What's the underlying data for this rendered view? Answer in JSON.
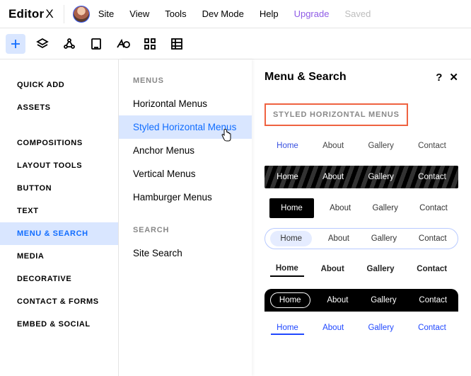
{
  "app": {
    "logo": "Editor",
    "logo_suffix": "X"
  },
  "menubar": {
    "site": "Site",
    "view": "View",
    "tools": "Tools",
    "devmode": "Dev Mode",
    "help": "Help",
    "upgrade": "Upgrade",
    "saved": "Saved"
  },
  "sidebar": {
    "groupA": [
      {
        "label": "QUICK ADD"
      },
      {
        "label": "ASSETS"
      }
    ],
    "groupB": [
      {
        "label": "COMPOSITIONS"
      },
      {
        "label": "LAYOUT TOOLS"
      },
      {
        "label": "BUTTON"
      },
      {
        "label": "TEXT"
      },
      {
        "label": "MENU & SEARCH",
        "selected": true
      },
      {
        "label": "MEDIA"
      },
      {
        "label": "DECORATIVE"
      },
      {
        "label": "CONTACT & FORMS"
      },
      {
        "label": "EMBED & SOCIAL"
      }
    ]
  },
  "subpanel": {
    "group1_label": "MENUS",
    "group1": [
      {
        "label": "Horizontal Menus"
      },
      {
        "label": "Styled Horizontal Menus",
        "selected": true
      },
      {
        "label": "Anchor Menus"
      },
      {
        "label": "Vertical Menus"
      },
      {
        "label": "Hamburger Menus"
      }
    ],
    "group2_label": "SEARCH",
    "group2": [
      {
        "label": "Site Search"
      }
    ]
  },
  "panel": {
    "title": "Menu & Search",
    "help": "?",
    "close": "✕",
    "section_title": "STYLED HORIZONTAL MENUS",
    "menu_items": [
      "Home",
      "About",
      "Gallery",
      "Contact"
    ]
  }
}
